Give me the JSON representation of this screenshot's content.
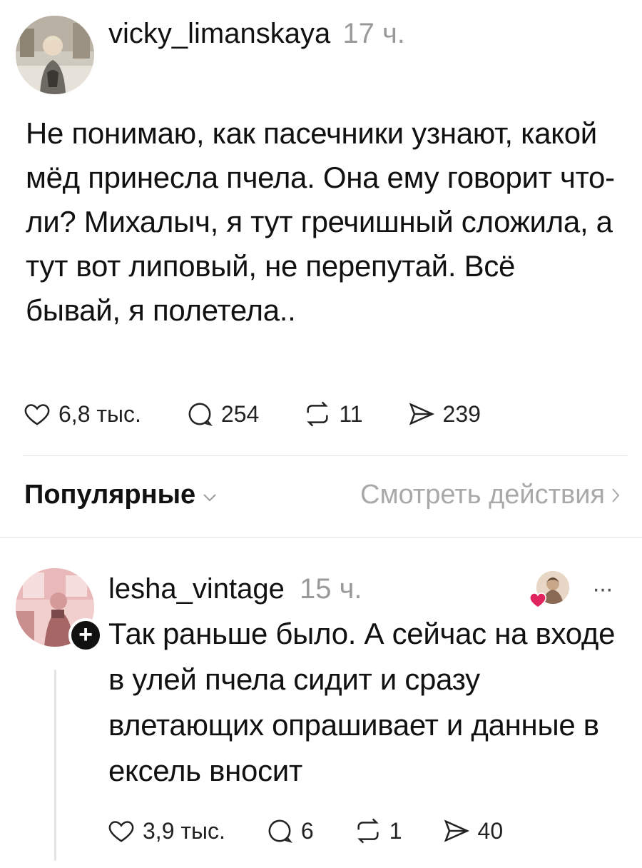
{
  "post": {
    "author": "vicky_limanskaya",
    "time": "17 ч.",
    "text": "Не понимаю, как пасечники узнают, какой мёд принесла пчела. Она ему говорит что-ли? Михалыч, я тут гречишный сложила, а тут вот липовый, не перепутай. Всё бывай, я полетела..",
    "likes": "6,8 тыс.",
    "comments": "254",
    "reposts": "11",
    "shares": "239"
  },
  "sort": {
    "label": "Популярные",
    "activity_link": "Смотреть действия"
  },
  "reply": {
    "author": "lesha_vintage",
    "time": "15 ч.",
    "text": "Так раньше было. А сейчас на входе в улей пчела сидит и сразу влетающих опрашивает и данные в ексель вносит",
    "likes": "3,9 тыс.",
    "comments": "6",
    "reposts": "1",
    "shares": "40",
    "more": "···"
  },
  "icons": {
    "like": "heart-icon",
    "comment": "speech-bubble-icon",
    "repost": "repost-icon",
    "share": "send-icon",
    "liked_by_author": "red-heart-icon",
    "follow": "plus-icon"
  },
  "colors": {
    "text": "#111111",
    "muted": "#9a9a9a",
    "liked_heart": "#e0245e"
  }
}
